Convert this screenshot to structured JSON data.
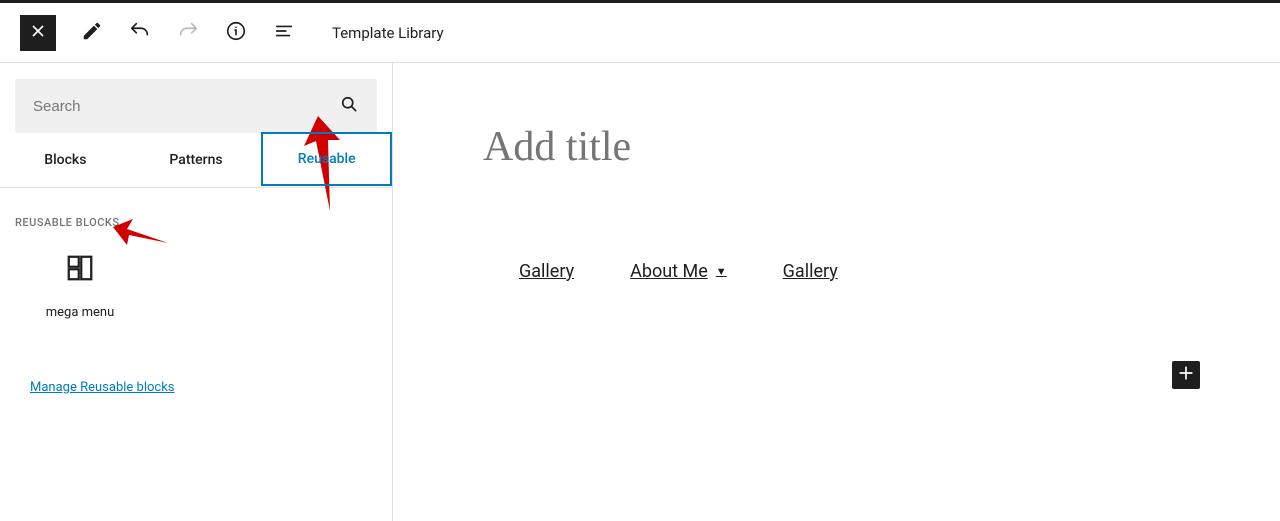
{
  "toolbar": {
    "template_library_label": "Template Library"
  },
  "sidebar": {
    "search": {
      "placeholder": "Search"
    },
    "tabs": [
      {
        "label": "Blocks"
      },
      {
        "label": "Patterns"
      },
      {
        "label": "Reusable"
      }
    ],
    "section_label": "REUSABLE BLOCKS",
    "blocks": [
      {
        "label": "mega menu"
      }
    ],
    "manage_link": "Manage Reusable blocks"
  },
  "editor": {
    "title_placeholder": "Add title",
    "nav_items": [
      {
        "label": "Gallery",
        "has_dropdown": false
      },
      {
        "label": "About Me",
        "has_dropdown": true
      },
      {
        "label": "Gallery",
        "has_dropdown": false
      }
    ]
  }
}
